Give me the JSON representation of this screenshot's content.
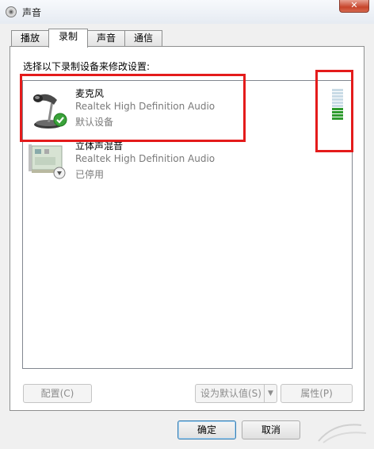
{
  "window": {
    "title": "声音",
    "close_label": "✕"
  },
  "tabs": [
    {
      "label": "播放",
      "active": false
    },
    {
      "label": "录制",
      "active": true
    },
    {
      "label": "声音",
      "active": false
    },
    {
      "label": "通信",
      "active": false
    }
  ],
  "instruction": "选择以下录制设备来修改设置:",
  "devices": [
    {
      "name": "麦克风",
      "description": "Realtek High Definition Audio",
      "status": "默认设备",
      "icon": "microphone-icon",
      "badge": "default-check-icon",
      "level_fraction": 0.4
    },
    {
      "name": "立体声混音",
      "description": "Realtek High Definition Audio",
      "status": "已停用",
      "icon": "sound-card-icon",
      "badge": "disabled-down-arrow-icon"
    }
  ],
  "buttons": {
    "configure": "配置(C)",
    "set_default": "设为默认值(S)",
    "properties": "属性(P)",
    "ok": "确定",
    "cancel": "取消"
  },
  "colors": {
    "highlight": "#e41b1b",
    "meter_on": "#2e9b2e",
    "meter_off": "#c9dbe6",
    "check": "#3aa23a"
  }
}
